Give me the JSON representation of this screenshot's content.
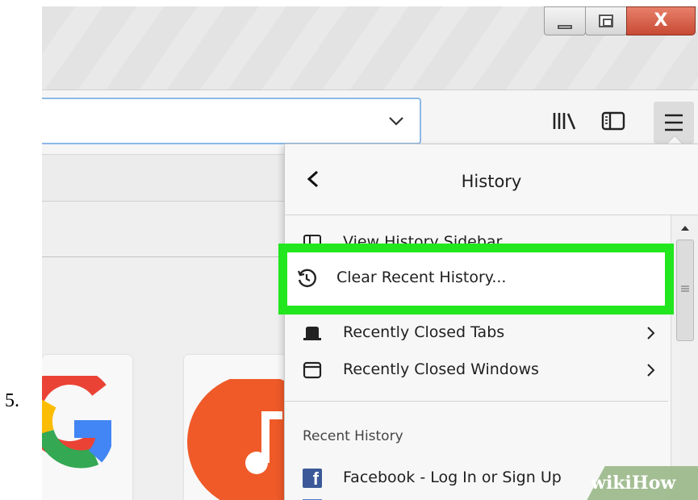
{
  "step": {
    "number": "5."
  },
  "window": {
    "minimize_icon": "minimize-icon",
    "maximize_icon": "restore-icon",
    "close_glyph": "X"
  },
  "toolbar": {
    "url_value": "",
    "icons": [
      "dropdown-chevron-icon",
      "library-icon",
      "sidebar-icon",
      "hamburger-menu-icon"
    ]
  },
  "history_panel": {
    "title": "History",
    "back_icon": "chevron-left-icon",
    "items": [
      {
        "label": "View History Sidebar",
        "icon": "sidebar-icon"
      },
      {
        "label": "Clear Recent History...",
        "icon": "history-clock-icon"
      },
      {
        "label": "Recently Closed Tabs",
        "icon": "tab-icon",
        "has_submenu": true
      },
      {
        "label": "Recently Closed Windows",
        "icon": "window-icon",
        "has_submenu": true
      }
    ],
    "section_label": "Recent History",
    "recent": [
      {
        "label": "Facebook - Log In or Sign Up",
        "icon": "facebook-icon"
      }
    ]
  },
  "content": {
    "tiles": [
      "google-icon",
      "music-icon"
    ]
  },
  "highlight": {
    "color": "#22e61e"
  },
  "watermark": {
    "wiki": "wiki",
    "how": "How"
  }
}
